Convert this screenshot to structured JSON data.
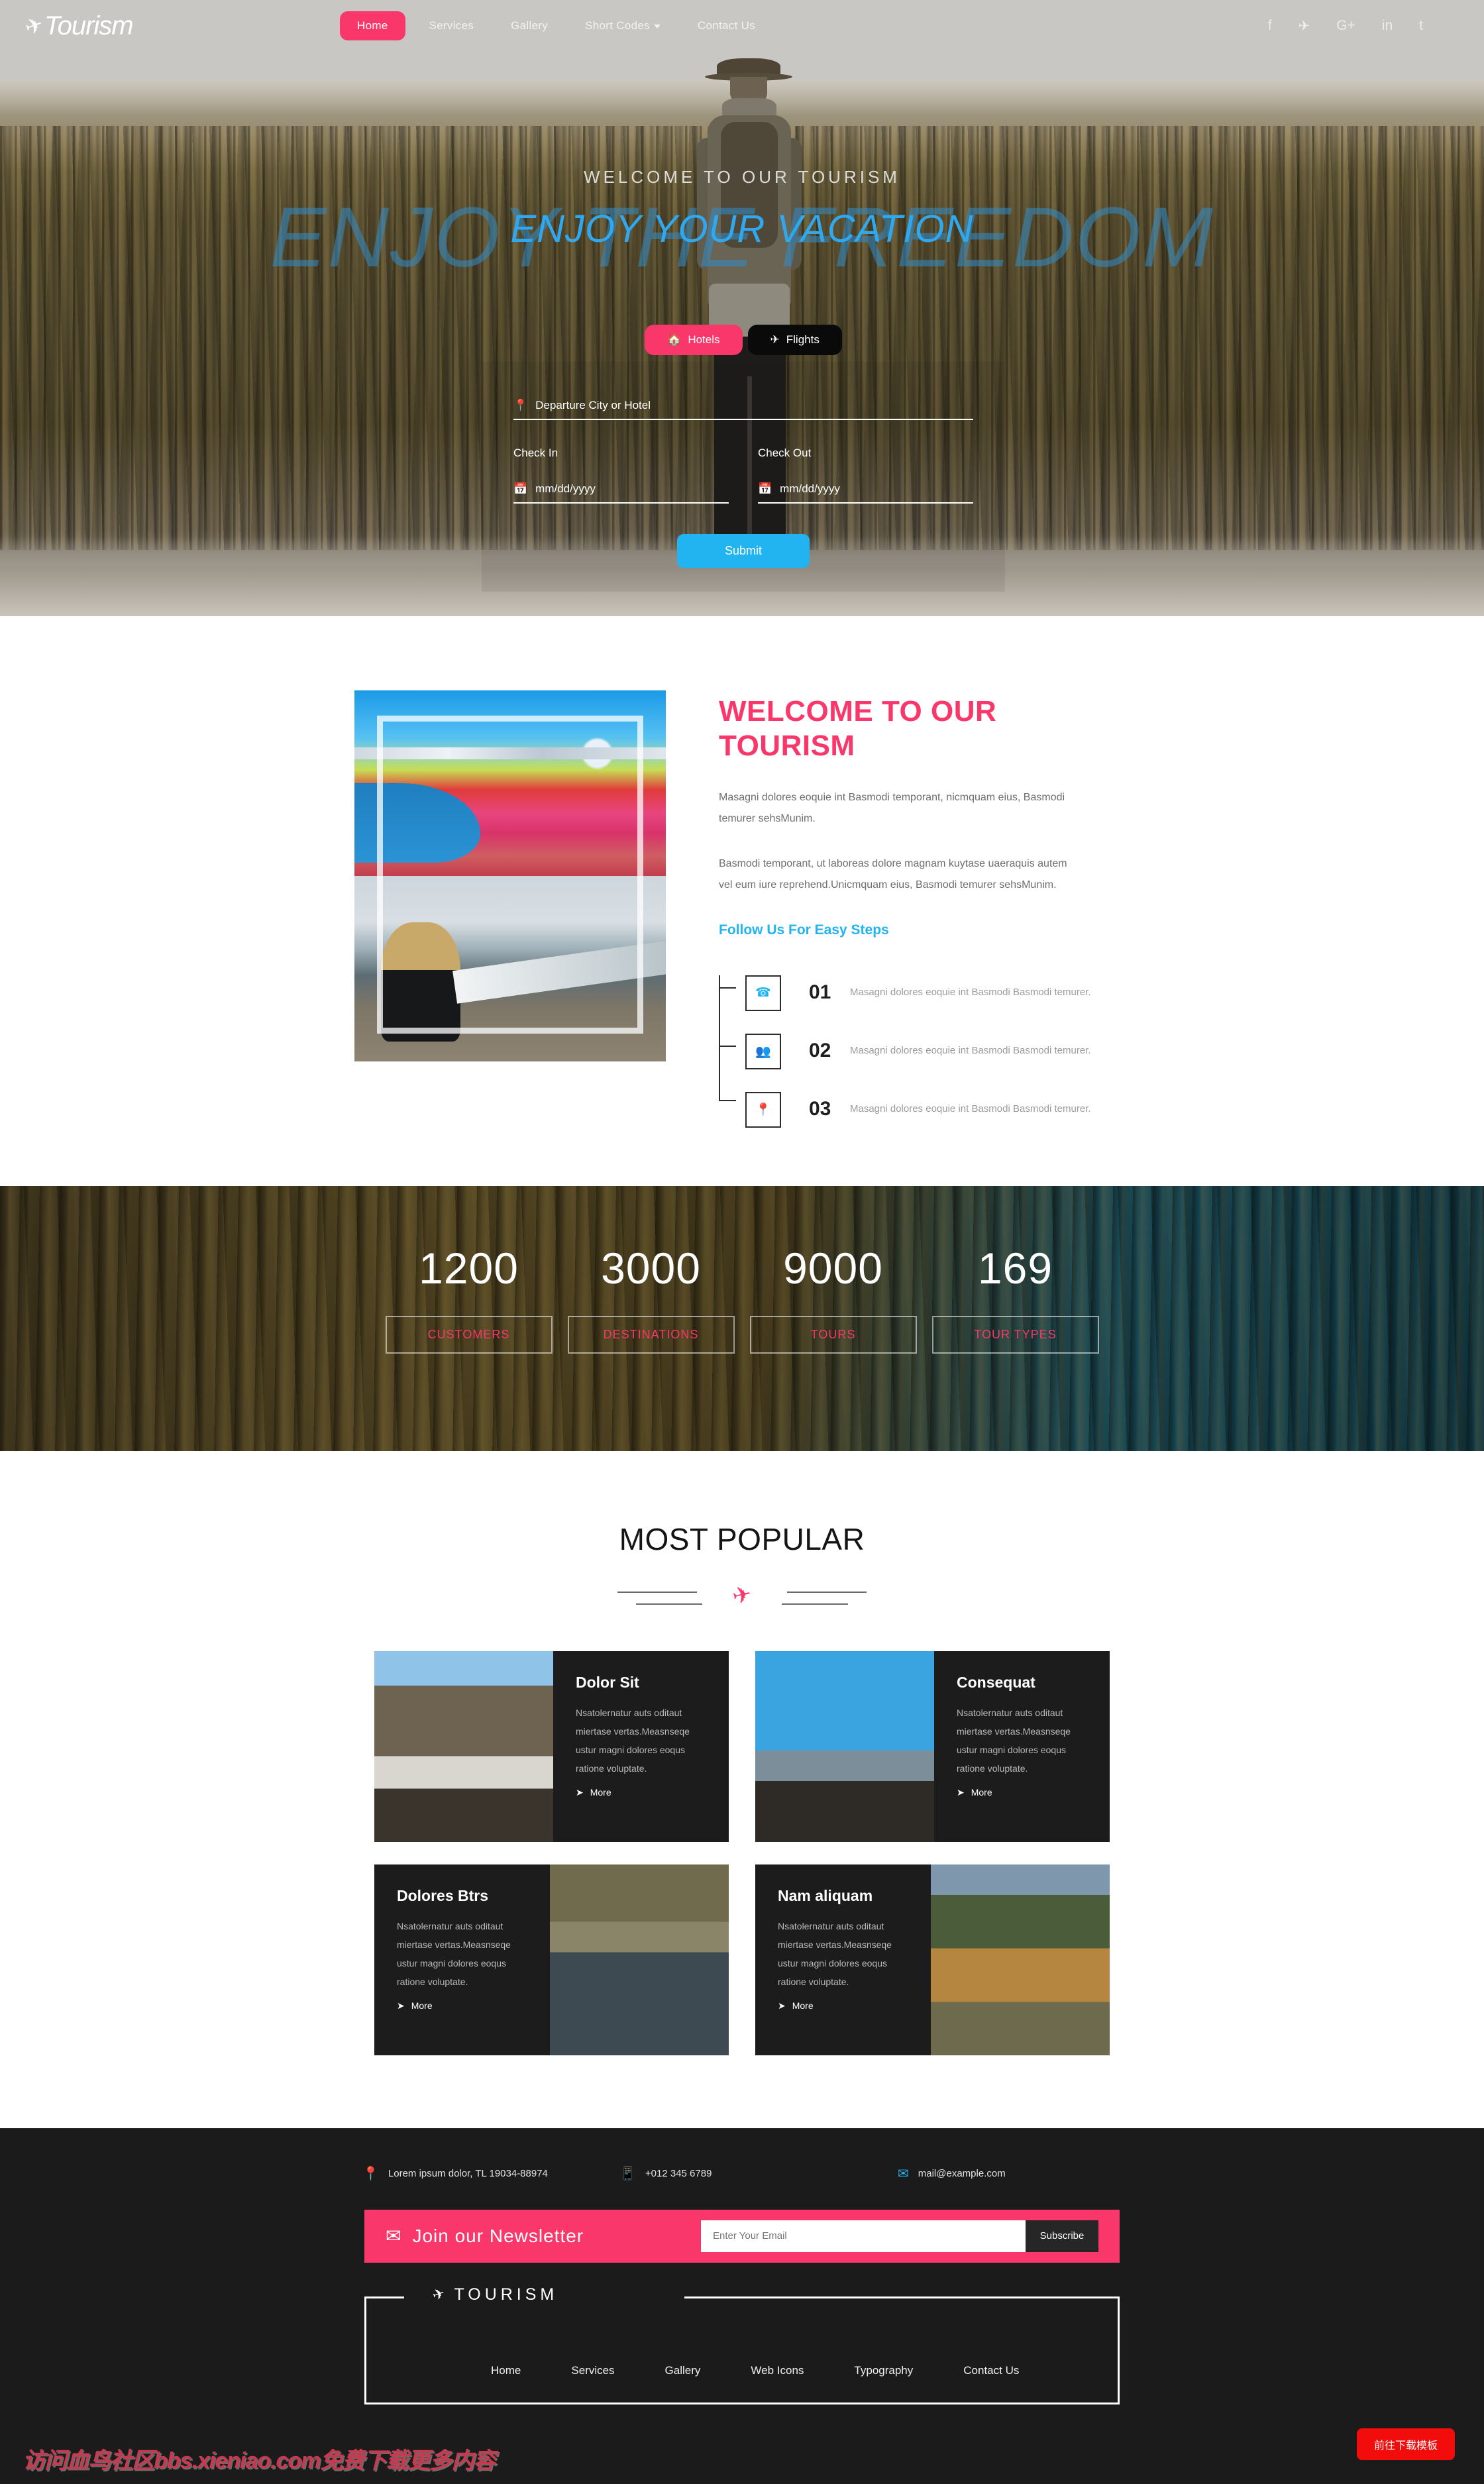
{
  "header": {
    "logo_text": "Tourism",
    "logo_icon": "plane-icon",
    "nav": [
      {
        "label": "Home",
        "active": true
      },
      {
        "label": "Services",
        "active": false
      },
      {
        "label": "Gallery",
        "active": false
      },
      {
        "label": "Short Codes",
        "active": false,
        "has_dropdown": true
      },
      {
        "label": "Contact Us",
        "active": false
      }
    ],
    "socials": [
      {
        "name": "facebook-icon",
        "glyph": "f"
      },
      {
        "name": "twitter-icon",
        "glyph": "✈"
      },
      {
        "name": "google-plus-icon",
        "glyph": "G+"
      },
      {
        "name": "linkedin-icon",
        "glyph": "in"
      },
      {
        "name": "tumblr-icon",
        "glyph": "t"
      }
    ]
  },
  "hero": {
    "ghost_text": "ENJOY THE FREEDOM",
    "subtitle": "WELCOME TO OUR TOURISM",
    "title": "ENJOY YOUR VACATION",
    "booking": {
      "tabs": [
        {
          "label": "Hotels",
          "icon": "home-icon",
          "active": true
        },
        {
          "label": "Flights",
          "icon": "plane-icon",
          "active": false
        }
      ],
      "destination_placeholder": "Departure City or Hotel",
      "destination_icon": "map-pin-icon",
      "checkin_label": "Check In",
      "checkin_value": "mm/dd/yyyy",
      "checkout_label": "Check Out",
      "checkout_value": "mm/dd/yyyy",
      "date_icon": "calendar-icon",
      "submit_label": "Submit"
    }
  },
  "welcome": {
    "title": "WELCOME TO OUR TOURISM",
    "paragraph1": "Masagni dolores eoquie int Basmodi temporant, nicmquam eius, Basmodi temurer sehsMunim.",
    "paragraph2": "Basmodi temporant, ut laboreas dolore magnam kuytase uaeraquis autem vel eum iure reprehend.Unicmquam eius, Basmodi temurer sehsMunim.",
    "steps_title": "Follow Us For Easy Steps",
    "steps": [
      {
        "num": "01",
        "icon": "phone-icon",
        "desc": "Masagni dolores eoquie int Basmodi Basmodi temurer."
      },
      {
        "num": "02",
        "icon": "users-icon",
        "desc": "Masagni dolores eoquie int Basmodi Basmodi temurer."
      },
      {
        "num": "03",
        "icon": "map-pin-icon",
        "desc": "Masagni dolores eoquie int Basmodi Basmodi temurer."
      }
    ]
  },
  "counters": [
    {
      "value": "1200",
      "label": "CUSTOMERS"
    },
    {
      "value": "3000",
      "label": "DESTINATIONS"
    },
    {
      "value": "9000",
      "label": "TOURS"
    },
    {
      "value": "169",
      "label": "TOUR TYPES"
    }
  ],
  "popular": {
    "title": "MOST POPULAR",
    "divider_icon": "plane-icon",
    "cards": [
      {
        "title": "Dolor Sit",
        "text": "Nsatolernatur auts oditaut miertase vertas.Measnseqe ustur magni dolores eoqus ratione voluptate.",
        "more_label": "More",
        "more_icon": "arrow-share-icon",
        "image_first": true
      },
      {
        "title": "Consequat",
        "text": "Nsatolernatur auts oditaut miertase vertas.Measnseqe ustur magni dolores eoqus ratione voluptate.",
        "more_label": "More",
        "more_icon": "arrow-share-icon",
        "image_first": true
      },
      {
        "title": "Dolores Btrs",
        "text": "Nsatolernatur auts oditaut miertase vertas.Measnseqe ustur magni dolores eoqus ratione voluptate.",
        "more_label": "More",
        "more_icon": "arrow-share-icon",
        "image_first": false
      },
      {
        "title": "Nam aliquam",
        "text": "Nsatolernatur auts oditaut miertase vertas.Measnseqe ustur magni dolores eoqus ratione voluptate.",
        "more_label": "More",
        "more_icon": "arrow-share-icon",
        "image_first": false
      }
    ]
  },
  "footer": {
    "address": "Lorem ipsum dolor, TL 19034-88974",
    "address_icon": "map-pin-icon",
    "phone": "+012 345 6789",
    "phone_icon": "mobile-icon",
    "email": "mail@example.com",
    "email_icon": "envelope-icon",
    "newsletter": {
      "label": "Join our Newsletter",
      "icon": "envelope-icon",
      "placeholder": "Enter Your Email",
      "button_label": "Subscribe"
    },
    "logo_text": "TOURISM",
    "logo_icon": "plane-icon",
    "nav": [
      {
        "label": "Home"
      },
      {
        "label": "Services"
      },
      {
        "label": "Gallery"
      },
      {
        "label": "Web Icons"
      },
      {
        "label": "Typography"
      },
      {
        "label": "Contact Us"
      }
    ],
    "watermark": "访问血鸟社区bbs.xieniao.com免费下载更多内容",
    "download_button": "前往下载模板"
  },
  "colors": {
    "pink": "#f9376b",
    "blue": "#22b4f0",
    "dark": "#1b1b1b",
    "red": "#f20c0c"
  }
}
